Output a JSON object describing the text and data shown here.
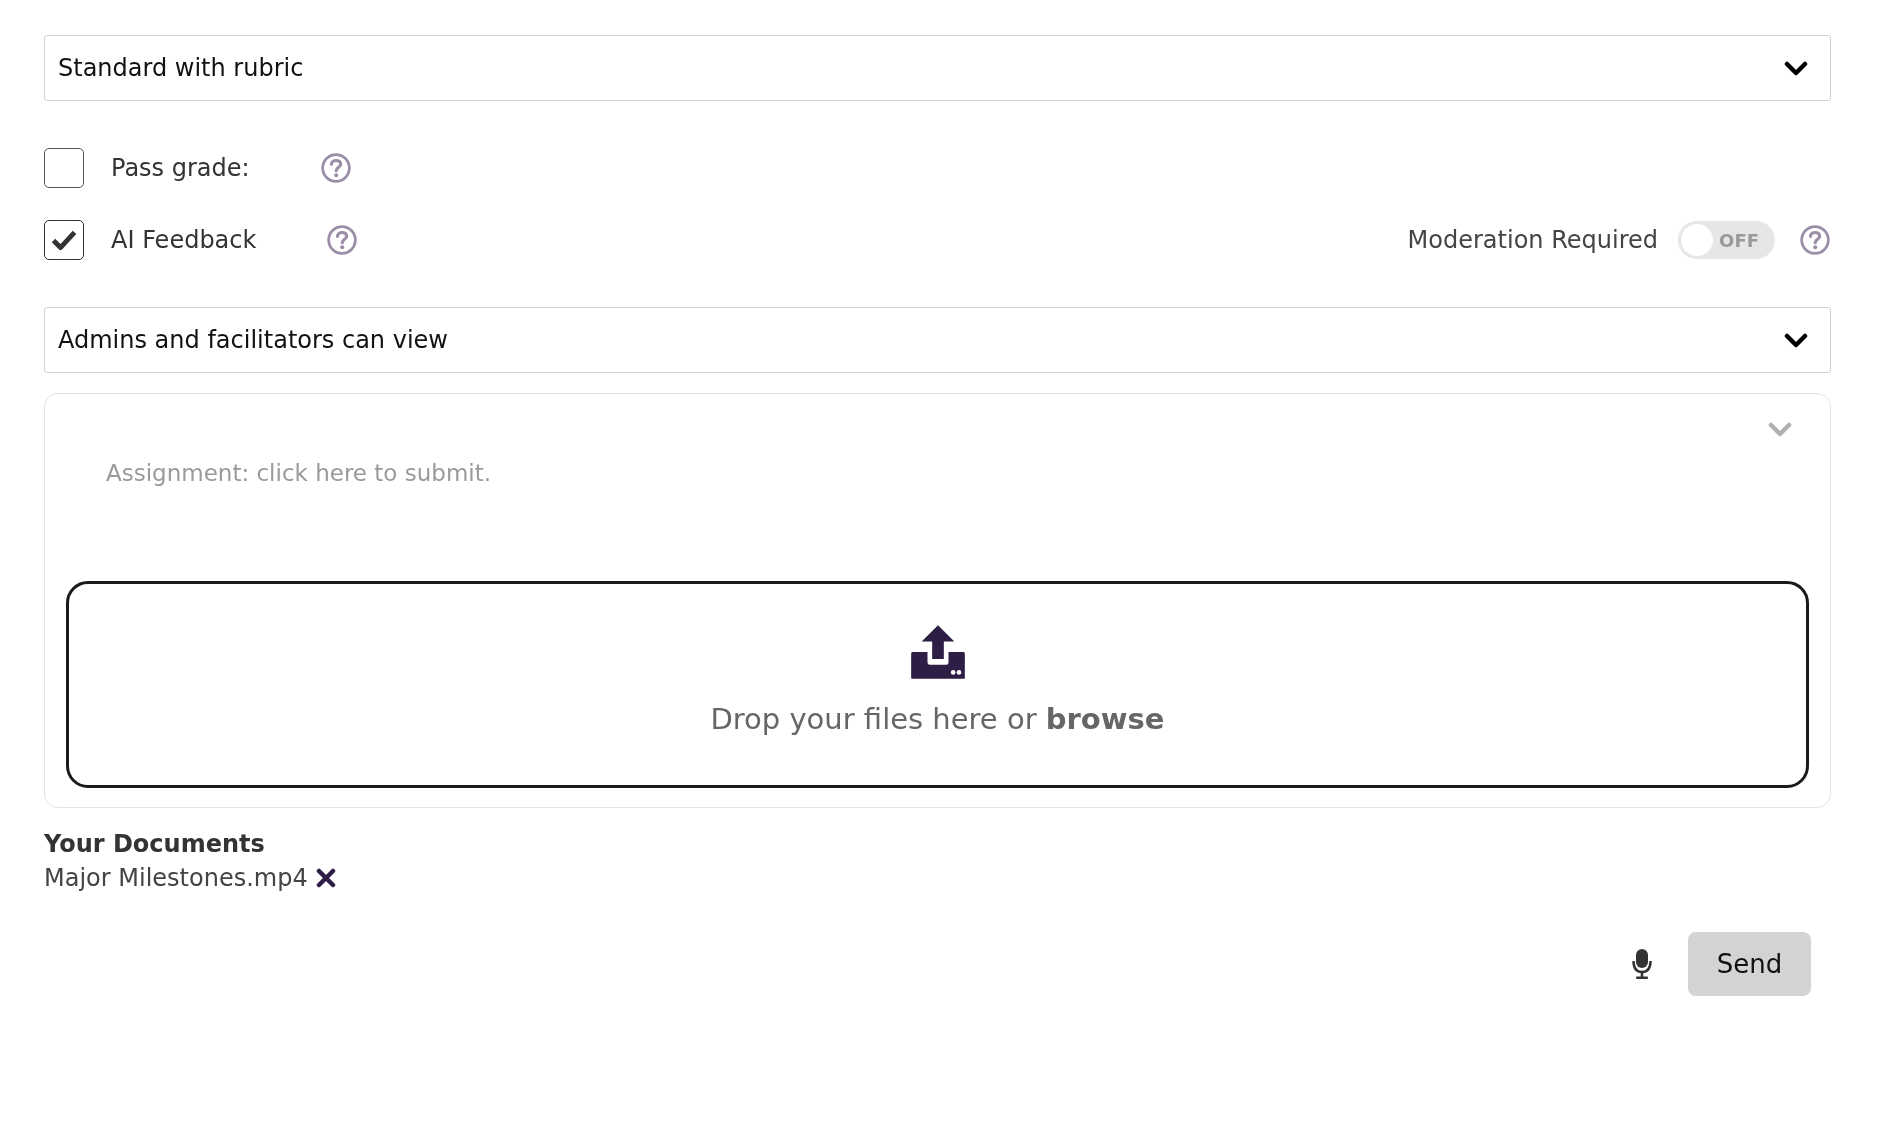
{
  "grading_dropdown": {
    "value": "Standard with rubric"
  },
  "options": [
    {
      "label": "Pass grade:",
      "checked": false
    },
    {
      "label": "AI Feedback",
      "checked": true
    }
  ],
  "moderation": {
    "label": "Moderation Required",
    "on": false,
    "state_text": "OFF"
  },
  "visibility_dropdown": {
    "value": "Admins and facilitators can view"
  },
  "submission": {
    "placeholder": "Assignment: click here to submit.",
    "dropzone_text": "Drop your files here or **browse**"
  },
  "documents": {
    "heading": "Your Documents",
    "files": [
      {
        "name": "Major Milestones.mp4"
      }
    ]
  },
  "send_button": "Send"
}
